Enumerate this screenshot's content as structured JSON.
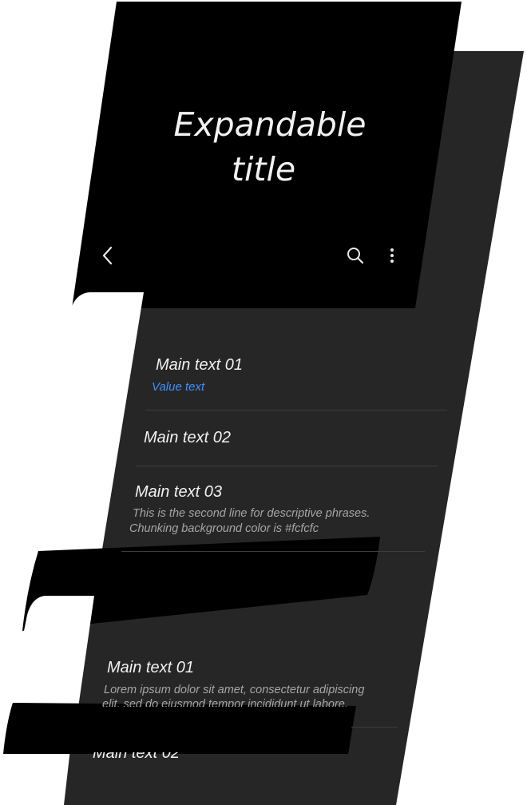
{
  "header": {
    "title_line1": "Expandable",
    "title_line2": "title"
  },
  "toolbar": {
    "back_icon": "chevron-left-icon",
    "search_icon": "search-icon",
    "more_icon": "more-vertical-icon"
  },
  "group1": {
    "items": [
      {
        "main": "Main text 01",
        "value": "Value text"
      },
      {
        "main": "Main text 02"
      },
      {
        "main": "Main text 03",
        "sub_line1": "This is the second line for descriptive phrases.",
        "sub_line2": "Chunking background color is #fcfcfc"
      }
    ]
  },
  "group2": {
    "items": [
      {
        "main": "Main text 01",
        "sub_line1": "Lorem ipsum dolor sit amet, consectetur adipiscing",
        "sub_line2": "elit, sed do eiusmod tempor incididunt ut labore."
      },
      {
        "main": "Main text 02"
      }
    ]
  },
  "colors": {
    "background_layer": "#262626",
    "front_layer": "#000000",
    "card_cutout": "#ffffff",
    "main_text": "#f1f1f1",
    "value_text": "#3e91ff",
    "secondary_text": "#a6a6a6",
    "divider": "#3d3d3d"
  }
}
